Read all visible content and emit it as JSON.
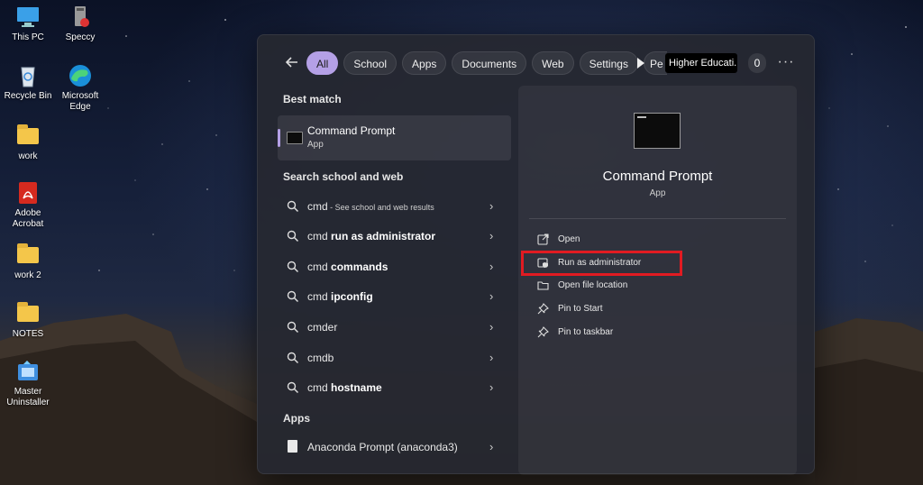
{
  "desktop": {
    "icons": [
      {
        "label": "This PC"
      },
      {
        "label": "Speccy"
      },
      {
        "label": "Recycle Bin"
      },
      {
        "label": "Microsoft Edge"
      },
      {
        "label": "work"
      },
      {
        "label": "Adobe Acrobat"
      },
      {
        "label": "work 2"
      },
      {
        "label": "NOTES"
      },
      {
        "label": "Master Uninstaller"
      }
    ]
  },
  "search": {
    "filters": [
      "All",
      "School",
      "Apps",
      "Documents",
      "Web",
      "Settings",
      "Pe"
    ],
    "active_filter": "All",
    "organization": "Higher Educati...",
    "points": "0",
    "more": "···"
  },
  "best_match": {
    "heading": "Best match",
    "name": "Command Prompt",
    "type": "App"
  },
  "web": {
    "heading": "Search school and web",
    "results": [
      {
        "prefix": "cmd",
        "bold": "",
        "hint": " - See school and web results"
      },
      {
        "prefix": "cmd ",
        "bold": "run as administrator",
        "hint": ""
      },
      {
        "prefix": "cmd ",
        "bold": "commands",
        "hint": ""
      },
      {
        "prefix": "cmd ",
        "bold": "ipconfig",
        "hint": ""
      },
      {
        "prefix": "cmd",
        "bold": "er",
        "hint": ""
      },
      {
        "prefix": "cmd",
        "bold": "b",
        "hint": ""
      },
      {
        "prefix": "cmd ",
        "bold": "hostname",
        "hint": ""
      }
    ]
  },
  "apps": {
    "heading": "Apps",
    "items": [
      {
        "name": "Anaconda Prompt (anaconda3)"
      }
    ]
  },
  "details": {
    "title": "Command Prompt",
    "type": "App",
    "actions": [
      {
        "label": "Open",
        "icon": "open-icon"
      },
      {
        "label": "Run as administrator",
        "icon": "shield-icon"
      },
      {
        "label": "Open file location",
        "icon": "folder-icon"
      },
      {
        "label": "Pin to Start",
        "icon": "pin-icon"
      },
      {
        "label": "Pin to taskbar",
        "icon": "pin-icon"
      }
    ],
    "highlighted_action": "Run as administrator"
  },
  "colors": {
    "accent": "#b4a0e6",
    "highlight": "#e11b22"
  }
}
